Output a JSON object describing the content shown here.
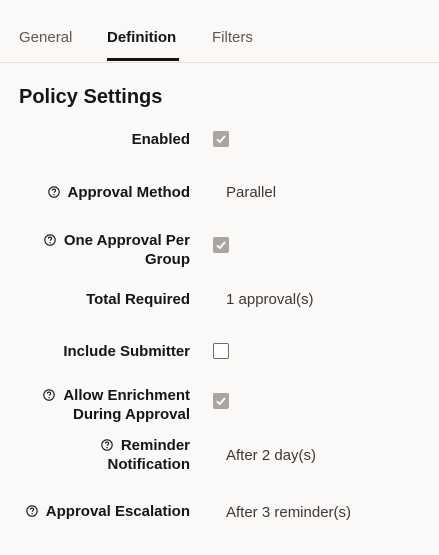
{
  "tabs": [
    {
      "label": "General",
      "active": false
    },
    {
      "label": "Definition",
      "active": true
    },
    {
      "label": "Filters",
      "active": false
    }
  ],
  "section_title": "Policy Settings",
  "fields": [
    {
      "label_lines": [
        "Enabled"
      ],
      "help": false,
      "checkbox": true,
      "checked": true
    },
    {
      "label_lines": [
        "Approval Method"
      ],
      "help": true,
      "value": "Parallel"
    },
    {
      "label_lines": [
        "One Approval Per",
        "Group"
      ],
      "help": true,
      "checkbox": true,
      "checked": true
    },
    {
      "label_lines": [
        "Total Required"
      ],
      "help": false,
      "value": "1 approval(s)"
    },
    {
      "label_lines": [
        "Include Submitter"
      ],
      "help": false,
      "checkbox": true,
      "checked": false
    },
    {
      "label_lines": [
        "Allow Enrichment",
        "During Approval"
      ],
      "help": true,
      "checkbox": true,
      "checked": true
    },
    {
      "label_lines": [
        "Reminder",
        "Notification"
      ],
      "help": true,
      "value": "After 2 day(s)"
    },
    {
      "label_lines": [
        "Approval Escalation"
      ],
      "help": true,
      "value": "After 3 reminder(s)"
    }
  ],
  "colors": {
    "background": "#fbf9f8",
    "text": "#161513",
    "checkbox_checked": "#a9a6a2",
    "divider": "#e4e1dd"
  }
}
